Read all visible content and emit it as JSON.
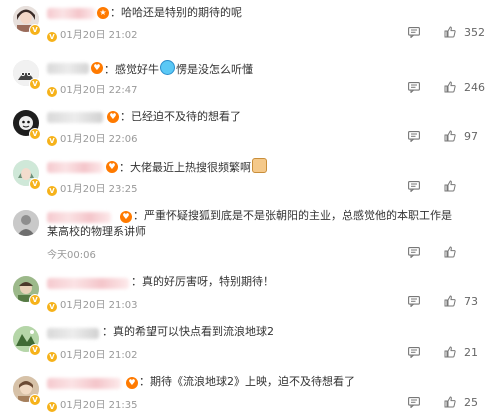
{
  "comments": [
    {
      "text": "：哈哈还是特别的期待的呢",
      "date": "01月20日 21:02",
      "likes": "352"
    },
    {
      "text": "：感觉好牛",
      "text_after_emoji": "愣是没怎么听懂",
      "date": "01月20日 22:47",
      "likes": "246"
    },
    {
      "text": "：已经迫不及待的想看了",
      "date": "01月20日 22:06",
      "likes": "97"
    },
    {
      "text": "：大佬最近上热搜很频繁啊",
      "date": "01月20日 23:25",
      "likes": ""
    },
    {
      "text": "：严重怀疑搜狐到底是不是张朝阳的主业，总感觉他的本职工作是某高校的物理系讲师",
      "date": "今天00:06",
      "likes": ""
    },
    {
      "text": "：真的好厉害呀，特别期待！",
      "date": "01月20日 21:03",
      "likes": "73"
    },
    {
      "text": "：真的希望可以快点看到流浪地球2",
      "date": "01月20日 21:02",
      "likes": "21"
    },
    {
      "text": "：期待《流浪地球2》上映，迫不及待想看了",
      "date": "01月20日 21:35",
      "likes": "25"
    }
  ],
  "colors": {
    "gold": "#f6b21a",
    "muted": "#999999",
    "text": "#333333"
  },
  "icons": {
    "reply": "comment-bubble-icon",
    "like": "thumbs-up-icon",
    "verified": "v-badge-icon"
  }
}
